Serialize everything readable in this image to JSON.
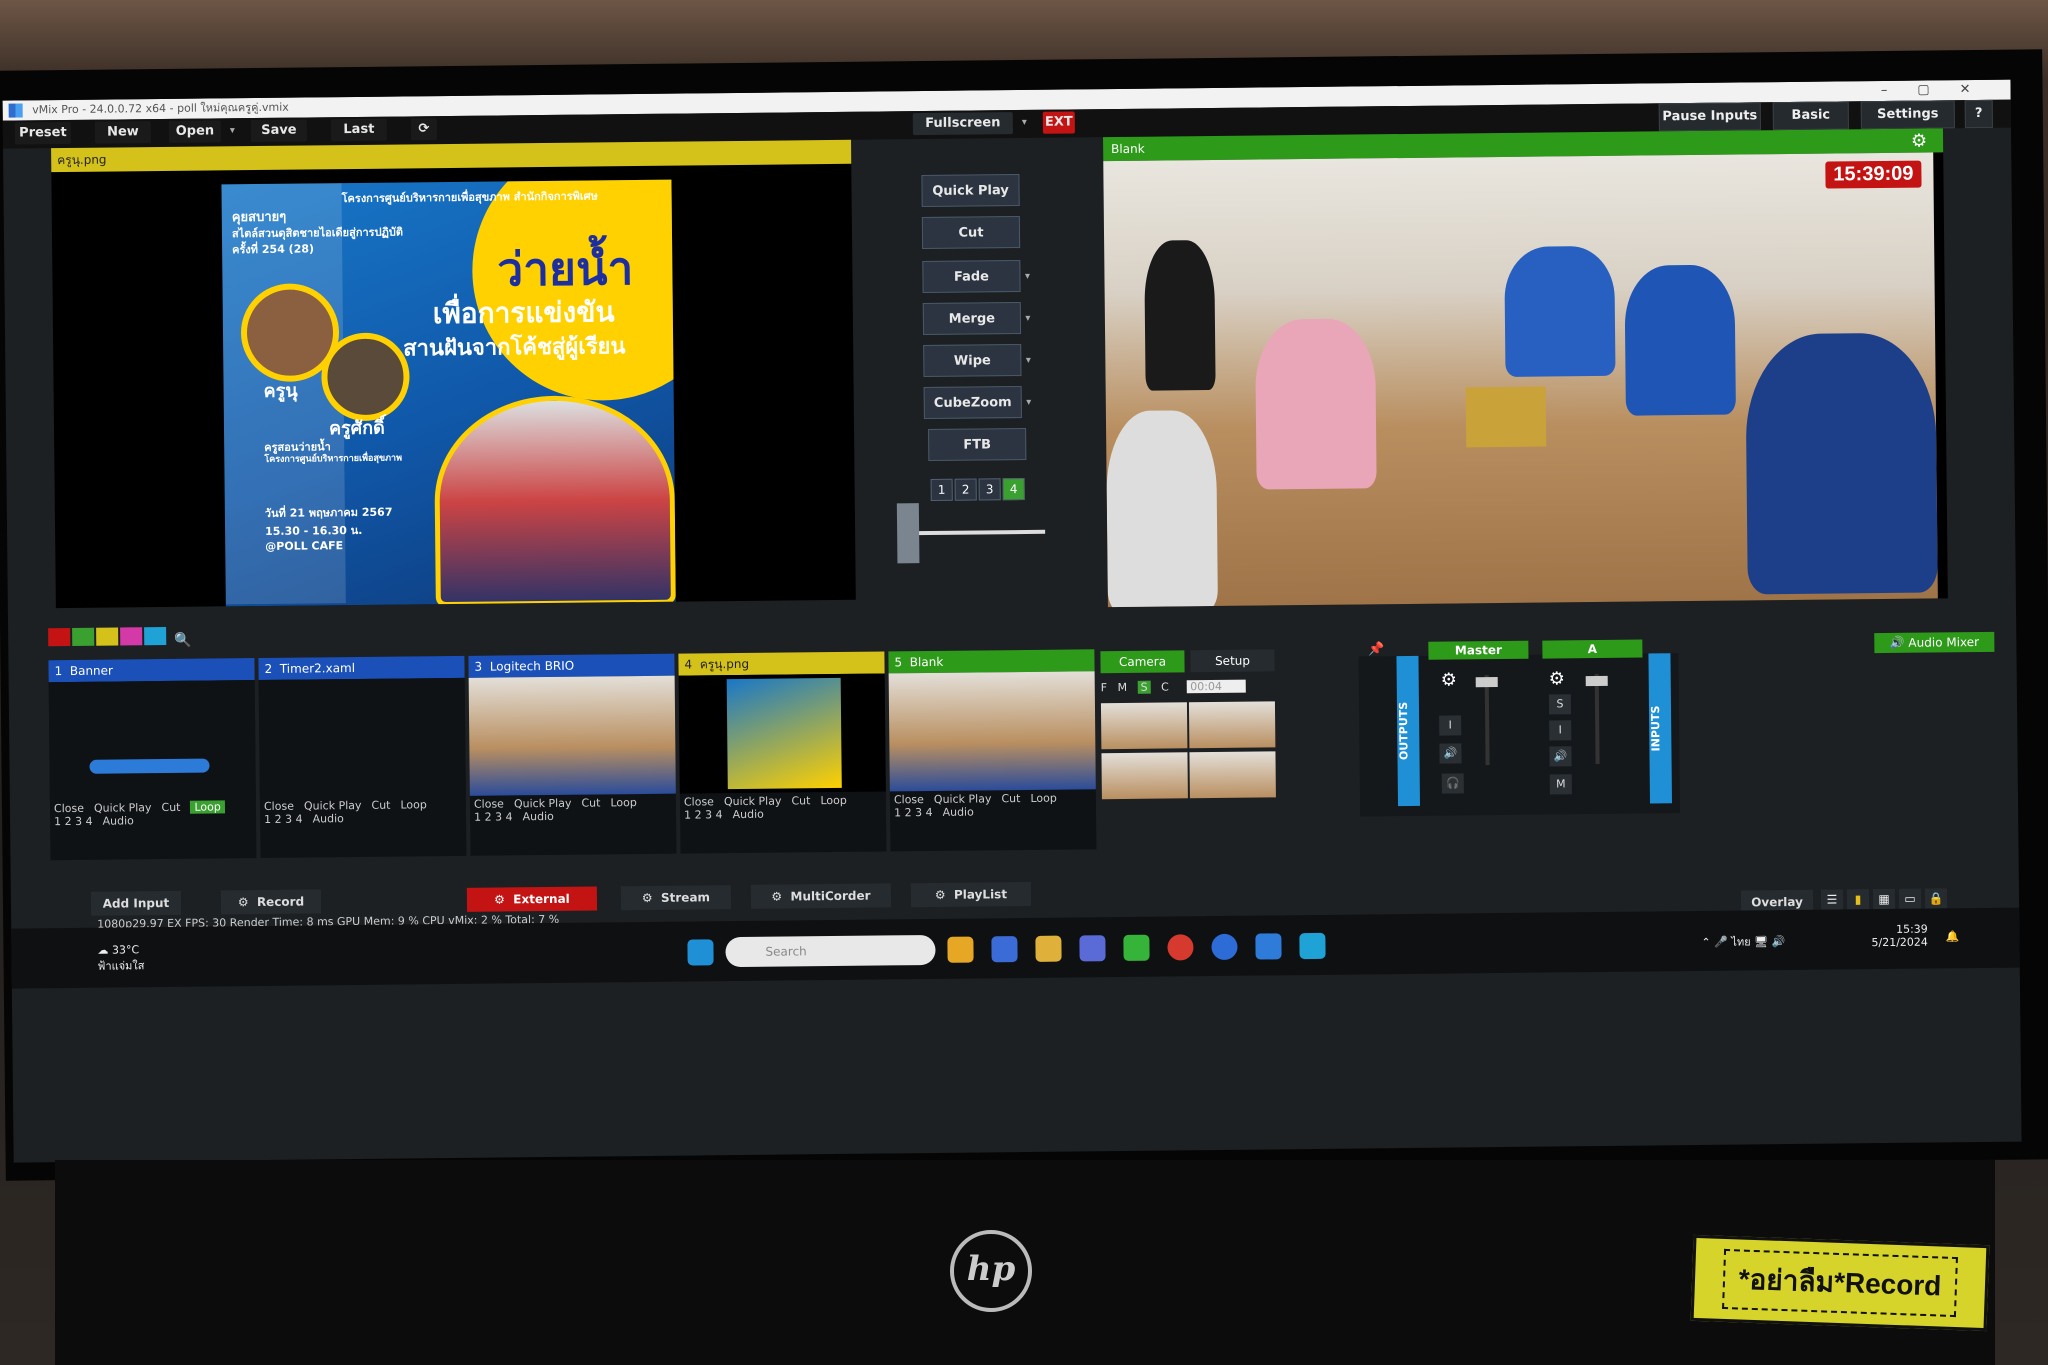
{
  "window": {
    "title": "vMix Pro - 24.0.0.72 x64 - poll ใหม่คุณครูคู่.vmix"
  },
  "menu": {
    "preset": "Preset",
    "new": "New",
    "open": "Open",
    "save": "Save",
    "last": "Last"
  },
  "top_right": {
    "pause_inputs": "Pause Inputs",
    "basic": "Basic",
    "settings": "Settings",
    "help": "?"
  },
  "fullscreen": {
    "label": "Fullscreen",
    "ext": "EXT"
  },
  "preview": {
    "title": "ครูนุ.png"
  },
  "poster": {
    "header": "โครงการศูนย์บริหารกายเพื่อสุขภาพ สำนักกิจการพิเศษ",
    "line1": "คุยสบายๆ",
    "line2": "สไตล์สวนดุสิตชายไอเดียสู่การปฏิบัติ",
    "line3": "ครั้งที่ 254 (28)",
    "main1": "ว่ายน้ำ",
    "main2": "เพื่อการแข่งขัน",
    "main3": "สานฝันจากโค้ชสู่ผู้เรียน",
    "name1": "ครูนุ",
    "name2": "ครูศักดิ์",
    "role": "ครูสอนว่ายน้ำ",
    "role2": "โครงการศูนย์บริหารกายเพื่อสุขภาพ",
    "date": "วันที่ 21 พฤษภาคม 2567",
    "time": "15.30 - 16.30 น.",
    "place": "@POLL CAFE"
  },
  "transitions": {
    "quick_play": "Quick Play",
    "cut": "Cut",
    "fade": "Fade",
    "merge": "Merge",
    "wipe": "Wipe",
    "cubezoom": "CubeZoom",
    "ftb": "FTB",
    "nums": [
      "1",
      "2",
      "3",
      "4"
    ]
  },
  "output": {
    "title": "Blank",
    "clock": "15:39:09"
  },
  "inputs": [
    {
      "num": "1",
      "name": "Banner",
      "color": "#1a50b8"
    },
    {
      "num": "2",
      "name": "Timer2.xaml",
      "color": "#1a50b8"
    },
    {
      "num": "3",
      "name": "Logitech BRIO",
      "color": "#1a50b8"
    },
    {
      "num": "4",
      "name": "ครูนุ.png",
      "color": "#d4c21a"
    },
    {
      "num": "5",
      "name": "Blank",
      "color": "#2e9a1a"
    }
  ],
  "input_controls": {
    "close": "Close",
    "quick_play": "Quick Play",
    "cut": "Cut",
    "loop": "Loop",
    "audio": "Audio",
    "nums": "1  2  3  4"
  },
  "camera_tabs": {
    "camera": "Camera",
    "setup": "Setup",
    "f": "F",
    "m": "M",
    "s": "S",
    "c": "C",
    "timecode": "00:04"
  },
  "audio": {
    "mixer_label": "Audio Mixer",
    "outputs": "OUTPUTS",
    "inputs": "INPUTS",
    "master": "Master",
    "a": "A",
    "s": "S",
    "i": "I",
    "m": "M"
  },
  "bottom": {
    "add_input": "Add Input",
    "record": "Record",
    "external": "External",
    "stream": "Stream",
    "multicorder": "MultiCorder",
    "playlist": "PlayList",
    "overlay": "Overlay"
  },
  "status": "1080p29.97   EX  FPS: 30  Render Time: 8 ms  GPU Mem: 9 %  CPU vMix: 2 %  Total: 7 %",
  "taskbar": {
    "search": "Search",
    "weather_temp": "33°C",
    "weather_desc": "ฟ้าแจ่มใส",
    "lang": "ไทย",
    "time": "15:39",
    "date": "5/21/2024"
  },
  "sticker": "*อย่าลืม*Record",
  "brand": "hp"
}
